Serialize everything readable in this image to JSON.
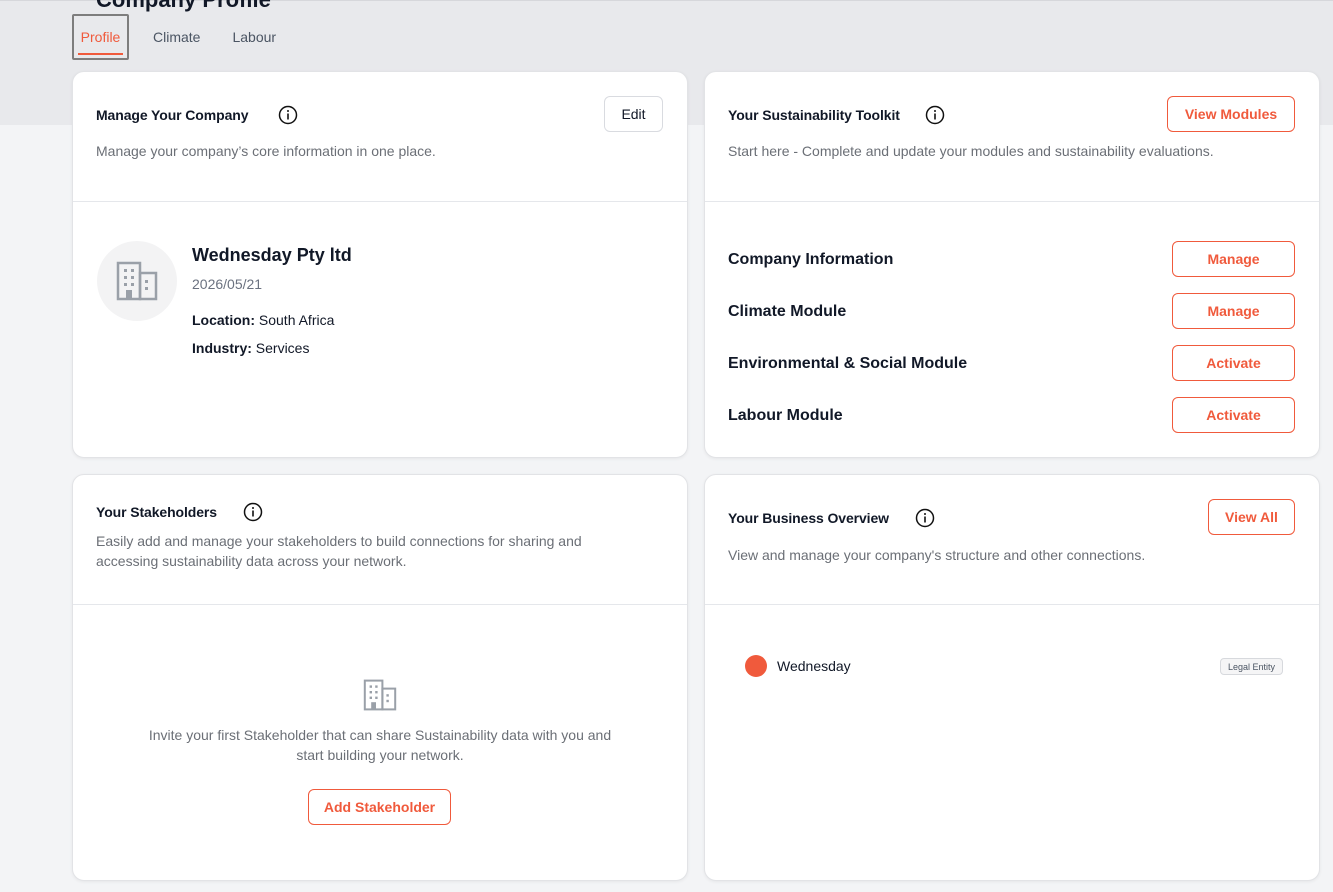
{
  "page": {
    "heading_partial": "Company Profile"
  },
  "tabs": [
    {
      "label": "Profile",
      "active": true
    },
    {
      "label": "Climate",
      "active": false
    },
    {
      "label": "Labour",
      "active": false
    }
  ],
  "manage_company": {
    "title": "Manage Your Company",
    "description": "Manage your company’s core information in one place.",
    "edit_label": "Edit",
    "company_name": "Wednesday Pty ltd",
    "date": "2026/05/21",
    "location_label": "Location:",
    "location_value": "South Africa",
    "industry_label": "Industry:",
    "industry_value": "Services"
  },
  "toolkit": {
    "title": "Your Sustainability Toolkit",
    "description": "Start here - Complete and update your modules and sustainability evaluations.",
    "view_modules_label": "View Modules",
    "modules": [
      {
        "name": "Company Information",
        "action": "Manage"
      },
      {
        "name": "Climate Module",
        "action": "Manage"
      },
      {
        "name": "Environmental & Social Module",
        "action": "Activate"
      },
      {
        "name": "Labour Module",
        "action": "Activate"
      }
    ]
  },
  "stakeholders": {
    "title": "Your Stakeholders",
    "description_line1": "Easily add and manage your stakeholders to build connections for sharing and",
    "description_line2": "accessing sustainability data across your network.",
    "empty_line1": "Invite your first Stakeholder that can share Sustainability data with you and",
    "empty_line2": "start building your network.",
    "add_label": "Add Stakeholder"
  },
  "business_overview": {
    "title": "Your Business Overview",
    "description": "View and manage your company's structure and other connections.",
    "view_all_label": "View All",
    "entity_name": "Wednesday",
    "entity_badge": "Legal Entity"
  },
  "colors": {
    "accent": "#f05a3c",
    "background": "#f3f4f6",
    "band": "#e8e9ec"
  }
}
